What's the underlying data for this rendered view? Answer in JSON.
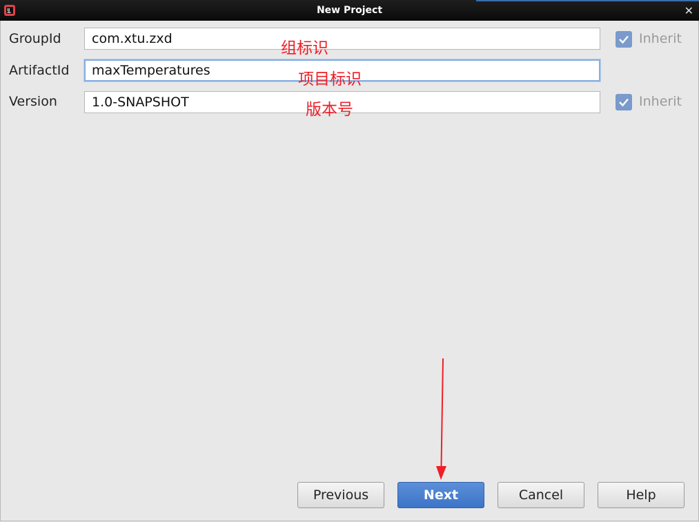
{
  "window": {
    "title": "New Project"
  },
  "form": {
    "group_label": "GroupId",
    "group_value": "com.xtu.zxd",
    "artifact_label": "ArtifactId",
    "artifact_value": "maxTemperatures",
    "version_label": "Version",
    "version_value": "1.0-SNAPSHOT",
    "inherit_label": "Inherit",
    "group_inherit_checked": true,
    "version_inherit_checked": true
  },
  "annotations": {
    "group": "组标识",
    "artifact": "项目标识",
    "version": "版本号"
  },
  "buttons": {
    "previous": "Previous",
    "next": "Next",
    "cancel": "Cancel",
    "help": "Help"
  },
  "colors": {
    "accent": "#3c74c8",
    "annotation": "#ee1f27",
    "checkbox": "#5e87c5"
  }
}
